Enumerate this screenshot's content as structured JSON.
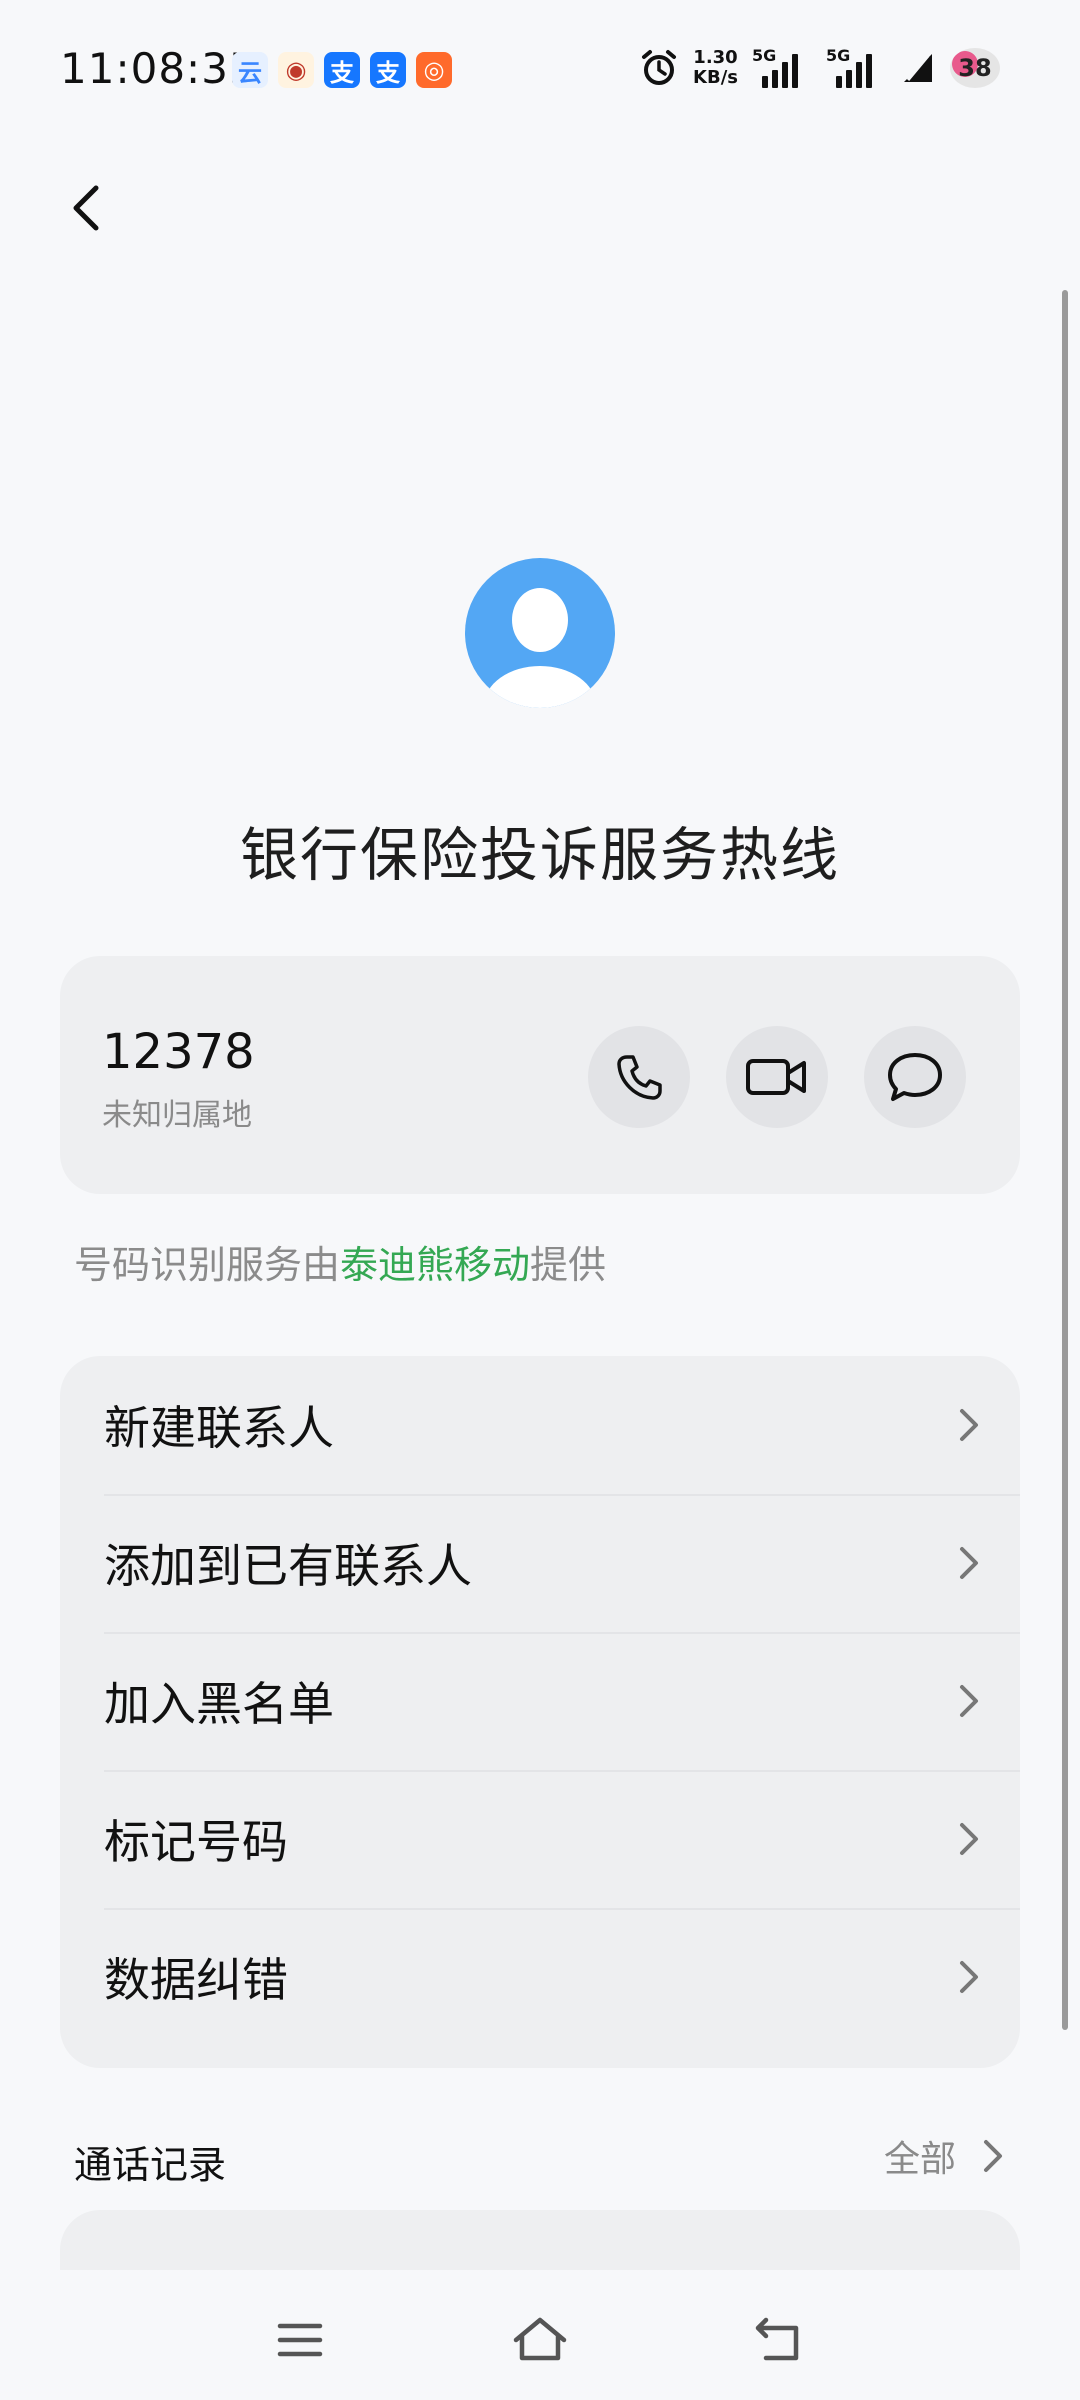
{
  "status_bar": {
    "time": "11:08:35",
    "apps": [
      {
        "icon": "cloud-app-icon",
        "glyph": "云",
        "color": "#3a86ff"
      },
      {
        "icon": "bank-app-icon",
        "glyph": "◉",
        "color": "#c0392b"
      },
      {
        "icon": "alipay-icon",
        "glyph": "支",
        "color": "#1677ff"
      },
      {
        "icon": "alipay-icon",
        "glyph": "支",
        "color": "#1677ff"
      },
      {
        "icon": "shopping-app-icon",
        "glyph": "◎",
        "color": "#ff6a2b"
      }
    ],
    "net_speed_value": "1.30",
    "net_speed_unit": "KB/s",
    "signal_label_1": "5G",
    "signal_label_2": "5G",
    "battery": "38"
  },
  "contact": {
    "name": "银行保险投诉服务热线",
    "phone_number": "12378",
    "location": "未知归属地"
  },
  "source_note": {
    "prefix": "号码识别服务由",
    "provider": "泰迪熊移动",
    "suffix": "提供"
  },
  "menu": [
    {
      "label": "新建联系人"
    },
    {
      "label": "添加到已有联系人"
    },
    {
      "label": "加入黑名单"
    },
    {
      "label": "标记号码"
    },
    {
      "label": "数据纠错"
    }
  ],
  "call_log": {
    "title": "通话记录",
    "all_label": "全部"
  },
  "colors": {
    "accent_green": "#34a853",
    "avatar_blue": "#53a7f4",
    "card_bg": "#eeeff1",
    "page_bg": "#f7f8fa"
  }
}
